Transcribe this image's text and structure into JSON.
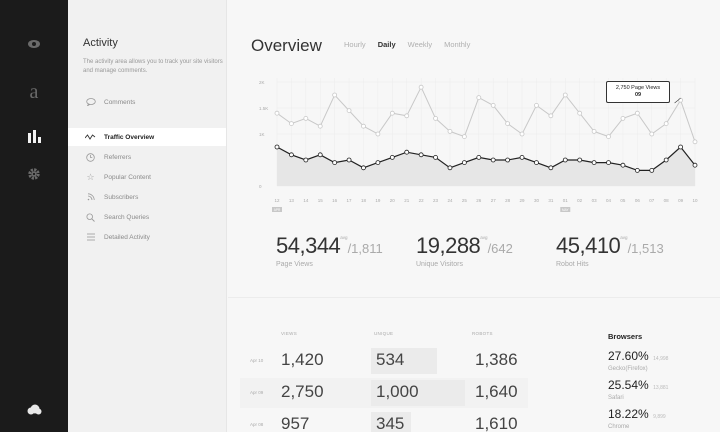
{
  "rail": {
    "icons": [
      "eye-icon",
      "letter-a-icon",
      "bar-chart-icon",
      "gear-icon",
      "cloud-icon"
    ]
  },
  "sidebar": {
    "title": "Activity",
    "description": "The activity area allows you to track your site visitors and manage comments.",
    "comments": "Comments",
    "items": [
      {
        "label": "Traffic Overview",
        "icon": "pulse-icon",
        "active": true
      },
      {
        "label": "Referrers",
        "icon": "clock-icon",
        "active": false
      },
      {
        "label": "Popular Content",
        "icon": "star-icon",
        "active": false
      },
      {
        "label": "Subscribers",
        "icon": "rss-icon",
        "active": false
      },
      {
        "label": "Search Queries",
        "icon": "search-icon",
        "active": false
      },
      {
        "label": "Detailed Activity",
        "icon": "list-icon",
        "active": false
      }
    ]
  },
  "overview": {
    "title": "Overview",
    "tabs": [
      "Hourly",
      "Daily",
      "Weekly",
      "Monthly"
    ],
    "active_tab": "Daily"
  },
  "chart_data": {
    "type": "line",
    "y_ticks": [
      "2K",
      "1.5K",
      "1K",
      "0"
    ],
    "ylim": [
      0,
      2000
    ],
    "x": [
      "12",
      "13",
      "14",
      "15",
      "16",
      "17",
      "18",
      "19",
      "20",
      "21",
      "22",
      "23",
      "24",
      "25",
      "26",
      "27",
      "28",
      "29",
      "30",
      "31",
      "01",
      "02",
      "03",
      "04",
      "05",
      "06",
      "07",
      "08",
      "09",
      "10"
    ],
    "month_markers": [
      {
        "at": "12",
        "label": "APR"
      },
      {
        "at": "01",
        "label": "MAY"
      }
    ],
    "series": [
      {
        "values": [
          1400,
          1200,
          1300,
          1150,
          1750,
          1450,
          1150,
          1000,
          1400,
          1350,
          1900,
          1300,
          1050,
          950,
          1700,
          1550,
          1200,
          1000,
          1550,
          1350,
          1750,
          1400,
          1050,
          950,
          1300,
          1400,
          1000,
          1200,
          1650,
          850
        ]
      },
      {
        "values": [
          750,
          600,
          500,
          600,
          450,
          500,
          350,
          450,
          550,
          650,
          600,
          550,
          350,
          450,
          550,
          500,
          500,
          550,
          450,
          350,
          500,
          500,
          450,
          450,
          400,
          300,
          300,
          500,
          750,
          400
        ]
      }
    ],
    "tooltip": {
      "text": "2,750 Page Views",
      "sub": "09"
    },
    "grid": true
  },
  "stats": [
    {
      "value": "54,344",
      "avg_label": "avg",
      "avg": "/1,811",
      "label": "Page Views"
    },
    {
      "value": "19,288",
      "avg_label": "avg",
      "avg": "/642",
      "label": "Unique Visitors"
    },
    {
      "value": "45,410",
      "avg_label": "avg",
      "avg": "/1,513",
      "label": "Robot Hits"
    }
  ],
  "table": {
    "headers": [
      "VIEWS",
      "UNIQUE",
      "ROBOTS"
    ],
    "rows": [
      {
        "date": "Apr 10",
        "views": "1,420",
        "unique": "534",
        "robots": "1,386"
      },
      {
        "date": "Apr 09",
        "views": "2,750",
        "unique": "1,000",
        "robots": "1,640"
      },
      {
        "date": "Apr 08",
        "views": "957",
        "unique": "345",
        "robots": "1,610"
      }
    ]
  },
  "browsers": {
    "title": "Browsers",
    "items": [
      {
        "pct": "27.60%",
        "count": "14,998",
        "name": "Gecko(Firefox)"
      },
      {
        "pct": "25.54%",
        "count": "13,881",
        "name": "Safari"
      },
      {
        "pct": "18.22%",
        "count": "9,899",
        "name": "Chrome"
      }
    ]
  }
}
